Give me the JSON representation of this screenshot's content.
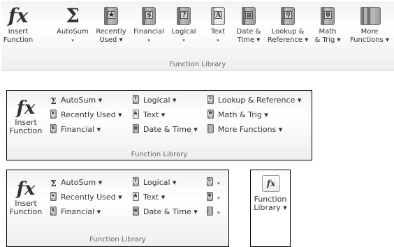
{
  "g1": {
    "title": "Function Library",
    "buttons": [
      {
        "l1": "Insert",
        "l2": "Function",
        "icon": "fx-icon"
      },
      {
        "l1": "AutoSum",
        "l2": "▾",
        "icon": "sigma-icon"
      },
      {
        "l1": "Recently",
        "l2": "Used ▾",
        "icon": "star-book-icon"
      },
      {
        "l1": "Financial",
        "l2": "▾",
        "icon": "financial-book-icon"
      },
      {
        "l1": "Logical",
        "l2": "▾",
        "icon": "logical-book-icon"
      },
      {
        "l1": "Text",
        "l2": "▾",
        "icon": "text-book-icon"
      },
      {
        "l1": "Date &",
        "l2": "Time ▾",
        "icon": "date-book-icon"
      },
      {
        "l1": "Lookup &",
        "l2": "Reference ▾",
        "icon": "lookup-book-icon"
      },
      {
        "l1": "Math",
        "l2": "& Trig ▾",
        "icon": "math-book-icon"
      },
      {
        "l1": "More",
        "l2": "Functions ▾",
        "icon": "more-books-icon"
      }
    ]
  },
  "g2": {
    "title": "Function Library",
    "insert": {
      "l1": "Insert",
      "l2": "Function"
    },
    "autosum": "AutoSum ▾",
    "recently": "Recently Used ▾",
    "financial": "Financial ▾",
    "logical": "Logical ▾",
    "text": "Text ▾",
    "datetime": "Date & Time ▾",
    "lookup": "Lookup & Reference ▾",
    "math": "Math & Trig ▾",
    "more": "More Functions ▾"
  },
  "g3": {
    "title": "Function Library",
    "insert": {
      "l1": "Insert",
      "l2": "Function"
    },
    "autosum": "AutoSum ▾",
    "recently": "Recently Used ▾",
    "financial": "Financial ▾",
    "logical": "Logical ▾",
    "text": "Text ▾",
    "datetime": "Date & Time ▾",
    "caret": "▾"
  },
  "g4": {
    "l1": "Function",
    "l2": "Library ▾"
  },
  "glyphs": {
    "fx": "fx",
    "sigma": "Σ",
    "star": "★",
    "question": "?",
    "A": "A",
    "theta": "θ",
    "cal": "▦",
    "mag": "⚲",
    "money": "$"
  }
}
